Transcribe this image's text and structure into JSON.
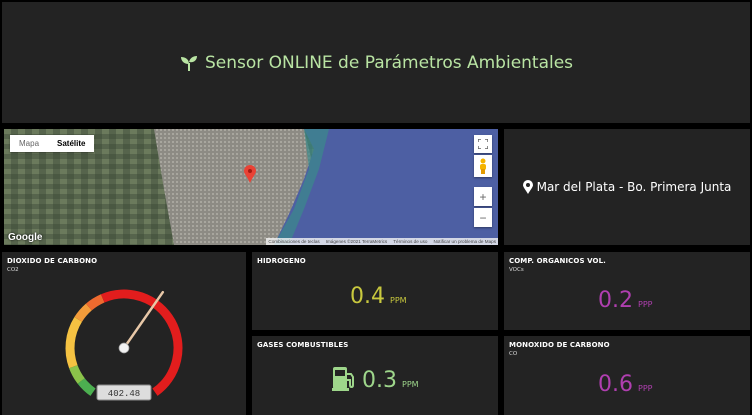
{
  "header": {
    "title": "Sensor ONLINE de Parámetros Ambientales"
  },
  "map": {
    "tabs": [
      "Mapa",
      "Satélite"
    ],
    "active_tab": "Satélite",
    "logo": "Google",
    "attribution": [
      "Combinaciones de teclas",
      "Imágenes ©2021 TerraMetrics",
      "Términos de uso",
      "Notificar un problema de Maps"
    ],
    "zoom_in": "+",
    "zoom_out": "−"
  },
  "location": {
    "text": "Mar del Plata - Bo. Primera Junta"
  },
  "co2": {
    "title": "DIOXIDO DE CARBONO",
    "sub": "CO2",
    "value": "402.48",
    "gauge_fraction": 0.62
  },
  "hidrogeno": {
    "title": "HIDROGENO",
    "value": "0.4",
    "unit": "PPM",
    "color": "#c8c83e"
  },
  "vocs": {
    "title": "COMP. ORGANICOS VOL.",
    "sub": "VOCs",
    "value": "0.2",
    "unit": "PPP",
    "color": "#b03fb0"
  },
  "gases": {
    "title": "GASES COMBUSTIBLES",
    "value": "0.3",
    "unit": "PPM",
    "color": "#9ed68b"
  },
  "co": {
    "title": "MONOXIDO DE CARBONO",
    "sub": "CO",
    "value": "0.6",
    "unit": "PPP",
    "color": "#b03fb0"
  },
  "colors": {
    "accent": "#b9e4a3",
    "panel": "#232323",
    "gauge_green": "#4caf50",
    "gauge_yellow": "#f5c242",
    "gauge_red": "#e21d1d"
  }
}
